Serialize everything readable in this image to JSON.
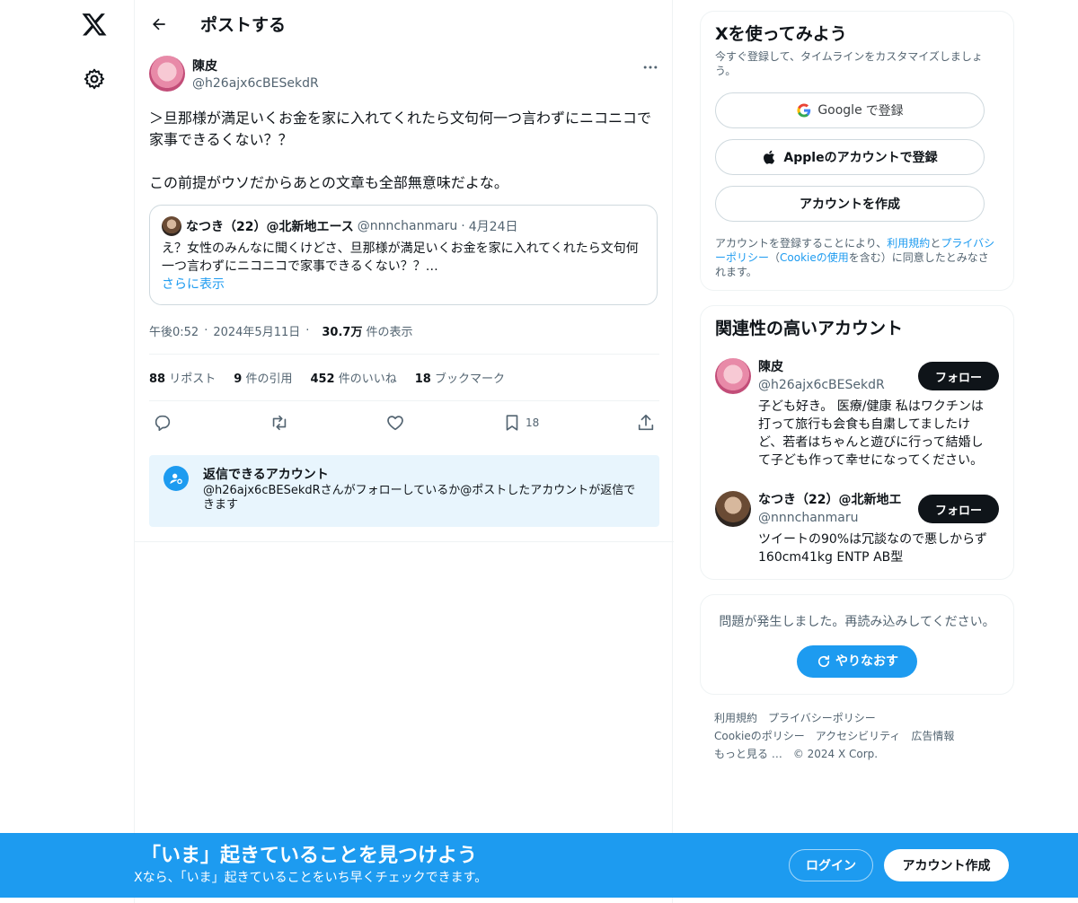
{
  "topbar": {
    "title": "ポストする"
  },
  "tweet": {
    "author_name": "陳皮",
    "author_handle": "@h26ajx6cBESekdR",
    "text": "＞旦那様が満足いくお金を家に入れてくれたら文句何一つ言わずにニコニコで家事できるくない？？\n\nこの前提がウソだからあとの文章も全部無意味だよな。",
    "quote": {
      "name": "なつき（22）@北新地エース",
      "handle": "@nnnchanmaru",
      "dot": "·",
      "date": "4月24日",
      "text": "え？女性のみんなに聞くけどさ、旦那様が満足いくお金を家に入れてくれたら文句何一つ言わずにニコニコで家事できるくない？？…",
      "show_more": "さらに表示"
    },
    "time": "午後0:52",
    "date": "2024年5月11日",
    "views_value": "30.7万",
    "views_label": "件の表示",
    "stats": {
      "reposts_value": "88",
      "reposts_label": "リポスト",
      "quotes_value": "9",
      "quotes_label": "件の引用",
      "likes_value": "452",
      "likes_label": "件のいいね",
      "bookmarks_value": "18",
      "bookmarks_label": "ブックマーク"
    },
    "bookmark_count": "18",
    "reply_box": {
      "title": "返信できるアカウント",
      "desc": "@h26ajx6cBESekdRさんがフォローしているか@ポストしたアカウントが返信できます"
    }
  },
  "signup_card": {
    "title": "Xを使ってみよう",
    "subtitle": "今すぐ登録して、タイムラインをカスタマイズしましょう。",
    "google_label": "Google",
    "google_suffix": "で登録",
    "apple_label": "Appleのアカウントで登録",
    "create_label": "アカウントを作成",
    "legal_prefix": "アカウントを登録することにより、",
    "legal_terms": "利用規約",
    "legal_and": "と",
    "legal_privacy": "プライバシーポリシー",
    "legal_paren_open": "（",
    "legal_cookie": "Cookieの使用",
    "legal_suffix": "を含む）に同意したとみなされます。"
  },
  "related": {
    "title": "関連性の高いアカウント",
    "accounts": [
      {
        "name": "陳皮",
        "handle": "@h26ajx6cBESekdR",
        "bio": "子ども好き。 医療/健康 私はワクチンは打って旅行も会食も自粛してましたけど、若者はちゃんと遊びに行って結婚して子ども作って幸せになってください。",
        "follow": "フォロー"
      },
      {
        "name": "なつき（22）@北新地エ",
        "handle": "@nnnchanmaru",
        "bio": "ツイートの90%は冗談なので悪しからず 160cm41kg ENTP AB型",
        "follow": "フォロー"
      }
    ]
  },
  "error_card": {
    "message": "問題が発生しました。再読み込みしてください。",
    "retry": "やりなおす"
  },
  "footer": {
    "terms": "利用規約",
    "privacy": "プライバシーポリシー",
    "cookie": "Cookieのポリシー",
    "accessibility": "アクセシビリティ",
    "ads": "広告情報",
    "more": "もっと見る …",
    "copyright": "© 2024 X Corp."
  },
  "banner": {
    "title": "「いま」起きていることを見つけよう",
    "subtitle": "Xなら、「いま」起きていることをいち早くチェックできます。",
    "login": "ログイン",
    "signup": "アカウント作成"
  },
  "colors": {
    "accent": "#1d9bf0",
    "text": "#0f1419",
    "muted": "#536471",
    "border": "#eff3f4"
  }
}
